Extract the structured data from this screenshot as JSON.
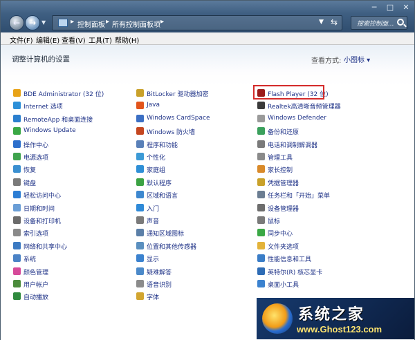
{
  "window": {
    "controls": {
      "minimize": "─",
      "maximize": "□",
      "close": "✕"
    }
  },
  "nav": {
    "breadcrumbs": [
      "控制面板",
      "所有控制面板项"
    ],
    "search_placeholder": "搜索控制面..."
  },
  "menu": [
    "文件(F)",
    "编辑(E)",
    "查看(V)",
    "工具(T)",
    "帮助(H)"
  ],
  "header": {
    "heading": "调整计算机的设置",
    "view_by_label": "查看方式:",
    "view_by_value": "小图标 ▾"
  },
  "columns": [
    [
      {
        "label": "BDE Administrator (32 位)",
        "icon": "bde-icon",
        "color": "#e8a317"
      },
      {
        "label": "Internet 选项",
        "icon": "internet-icon",
        "color": "#2c8fd8"
      },
      {
        "label": "RemoteApp 和桌面连接",
        "icon": "remote-icon",
        "color": "#2b7fce"
      },
      {
        "label": "Windows Update",
        "icon": "update-icon",
        "color": "#3aa845"
      },
      {
        "label": "操作中心",
        "icon": "flag-icon",
        "color": "#2c6fcc"
      },
      {
        "label": "电源选项",
        "icon": "power-icon",
        "color": "#3fa34d"
      },
      {
        "label": "恢复",
        "icon": "recovery-icon",
        "color": "#3a8fd0"
      },
      {
        "label": "键盘",
        "icon": "keyboard-icon",
        "color": "#7a7a7a"
      },
      {
        "label": "轻松访问中心",
        "icon": "access-icon",
        "color": "#2c7dd4"
      },
      {
        "label": "日期和时间",
        "icon": "clock-icon",
        "color": "#6a9ed6"
      },
      {
        "label": "设备和打印机",
        "icon": "printer-icon",
        "color": "#6b6b6b"
      },
      {
        "label": "索引选项",
        "icon": "index-icon",
        "color": "#8a8a8a"
      },
      {
        "label": "网络和共享中心",
        "icon": "network-icon",
        "color": "#3c7ac2"
      },
      {
        "label": "系统",
        "icon": "system-icon",
        "color": "#4b83c6"
      },
      {
        "label": "颜色管理",
        "icon": "color-icon",
        "color": "#d64a9a"
      },
      {
        "label": "用户帐户",
        "icon": "user-icon",
        "color": "#4b8b3b"
      },
      {
        "label": "自动播放",
        "icon": "autoplay-icon",
        "color": "#2f8a3e"
      }
    ],
    [
      {
        "label": "BitLocker 驱动器加密",
        "icon": "bitlocker-icon",
        "color": "#c9a12a"
      },
      {
        "label": "Java",
        "icon": "java-icon",
        "color": "#e2541b"
      },
      {
        "label": "Windows CardSpace",
        "icon": "cardspace-icon",
        "color": "#3b6fc4"
      },
      {
        "label": "Windows 防火墙",
        "icon": "firewall-icon",
        "color": "#c4461f"
      },
      {
        "label": "程序和功能",
        "icon": "programs-icon",
        "color": "#5980b8"
      },
      {
        "label": "个性化",
        "icon": "personalize-icon",
        "color": "#3c9ad6"
      },
      {
        "label": "家庭组",
        "icon": "homegroup-icon",
        "color": "#2e8fd6"
      },
      {
        "label": "默认程序",
        "icon": "default-icon",
        "color": "#3ba243"
      },
      {
        "label": "区域和语言",
        "icon": "region-icon",
        "color": "#3c87cf"
      },
      {
        "label": "入门",
        "icon": "getstarted-icon",
        "color": "#2f8ad8"
      },
      {
        "label": "声音",
        "icon": "sound-icon",
        "color": "#7a7a7a"
      },
      {
        "label": "通知区域图标",
        "icon": "tray-icon",
        "color": "#5b7fa8"
      },
      {
        "label": "位置和其他传感器",
        "icon": "sensor-icon",
        "color": "#5a8fbf"
      },
      {
        "label": "显示",
        "icon": "display-icon",
        "color": "#3b82cf"
      },
      {
        "label": "疑难解答",
        "icon": "troubleshoot-icon",
        "color": "#4b89c9"
      },
      {
        "label": "语音识别",
        "icon": "mic-icon",
        "color": "#8b8b8b"
      },
      {
        "label": "字体",
        "icon": "font-icon",
        "color": "#d2a530"
      }
    ],
    [
      {
        "label": "Flash Player (32 位)",
        "icon": "flash-icon",
        "color": "#9b1b1b"
      },
      {
        "label": "Realtek高清晰音频管理器",
        "icon": "realtek-icon",
        "color": "#3a3a3a"
      },
      {
        "label": "Windows Defender",
        "icon": "defender-icon",
        "color": "#9a9a9a"
      },
      {
        "label": "备份和还原",
        "icon": "backup-icon",
        "color": "#3aa05c"
      },
      {
        "label": "电话和调制解调器",
        "icon": "phone-icon",
        "color": "#7a7a7a"
      },
      {
        "label": "管理工具",
        "icon": "admintools-icon",
        "color": "#8a8a8a"
      },
      {
        "label": "家长控制",
        "icon": "parental-icon",
        "color": "#d98a2a"
      },
      {
        "label": "凭据管理器",
        "icon": "credential-icon",
        "color": "#c9a12a"
      },
      {
        "label": "任务栏和「开始」菜单",
        "icon": "taskbar-icon",
        "color": "#6b7d92"
      },
      {
        "label": "设备管理器",
        "icon": "devicemgr-icon",
        "color": "#6d6d6d"
      },
      {
        "label": "鼠标",
        "icon": "mouse-icon",
        "color": "#7a7a7a"
      },
      {
        "label": "同步中心",
        "icon": "sync-icon",
        "color": "#3aa845"
      },
      {
        "label": "文件夹选项",
        "icon": "folder-icon",
        "color": "#e3b33a"
      },
      {
        "label": "性能信息和工具",
        "icon": "performance-icon",
        "color": "#3a7dc7"
      },
      {
        "label": "英特尔(R) 核芯显卡",
        "icon": "intel-icon",
        "color": "#2e6cb5"
      },
      {
        "label": "桌面小工具",
        "icon": "gadget-icon",
        "color": "#3b82cf"
      }
    ]
  ],
  "watermark": {
    "title": "系统之家",
    "url": "www.Ghost123.com"
  }
}
